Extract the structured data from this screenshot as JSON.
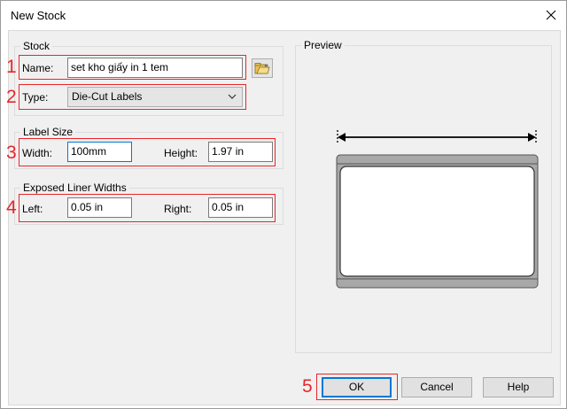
{
  "window": {
    "title": "New Stock",
    "close_icon": "close-icon"
  },
  "stock": {
    "group_label": "Stock",
    "name_label": "Name:",
    "name_value": "set kho giấy in 1 tem",
    "type_label": "Type:",
    "type_value": "Die-Cut Labels",
    "browse_icon": "folder-open-icon"
  },
  "label_size": {
    "group_label": "Label Size",
    "width_label": "Width:",
    "width_value": "100mm",
    "height_label": "Height:",
    "height_value": "1.97 in"
  },
  "exposed_liner": {
    "group_label": "Exposed Liner Widths",
    "left_label": "Left:",
    "left_value": "0.05 in",
    "right_label": "Right:",
    "right_value": "0.05 in"
  },
  "preview": {
    "group_label": "Preview"
  },
  "buttons": {
    "ok": "OK",
    "cancel": "Cancel",
    "help": "Help"
  },
  "annotations": [
    "1",
    "2",
    "3",
    "4",
    "5"
  ],
  "colors": {
    "highlight": "#e8262a",
    "focus": "#0078d7"
  }
}
